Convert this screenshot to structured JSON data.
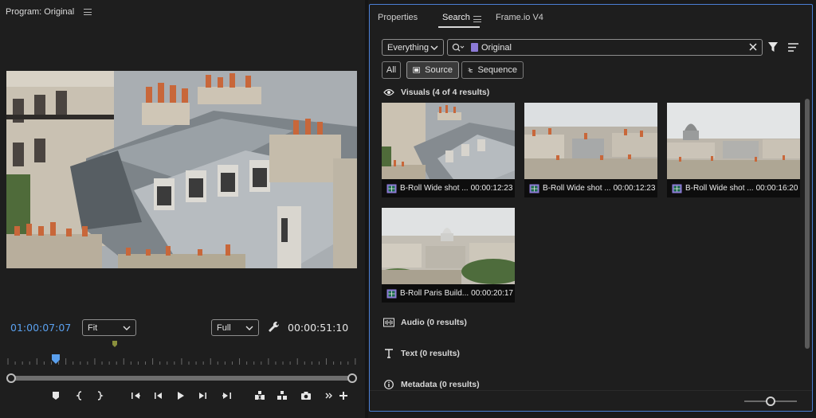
{
  "program": {
    "title": "Program: Original",
    "current_timecode": "01:00:07:07",
    "fit_value": "Fit",
    "resolution_value": "Full",
    "duration_timecode": "00:00:51:10",
    "playhead_fraction": 0.14,
    "transport_icons": [
      "add-marker-icon",
      "mark-in-icon",
      "mark-out-icon",
      "go-to-in-icon",
      "step-back-icon",
      "play-icon",
      "step-forward-icon",
      "go-to-out-icon",
      "lift-icon",
      "extract-icon",
      "export-frame-icon",
      "more-icon",
      "add-button-icon"
    ]
  },
  "search": {
    "tabs": [
      {
        "label": "Properties"
      },
      {
        "label": "Search"
      },
      {
        "label": "Frame.io V4"
      }
    ],
    "active_tab": "Search",
    "scope_value": "Everything",
    "query_value": "Original",
    "filter_chips": {
      "all": "All",
      "source": "Source",
      "sequence": "Sequence"
    },
    "active_chip": "Source",
    "visuals_header": "Visuals (4 of 4 results)",
    "results": [
      {
        "name": "B-Roll Wide shot ...",
        "duration": "00:00:12:23"
      },
      {
        "name": "B-Roll Wide shot ...",
        "duration": "00:00:12:23"
      },
      {
        "name": "B-Roll Wide shot ...",
        "duration": "00:00:16:20"
      },
      {
        "name": "B-Roll Paris Build...",
        "duration": "00:00:20:17"
      }
    ],
    "audio_header": "Audio (0 results)",
    "text_header": "Text (0 results)",
    "metadata_header": "Metadata (0 results)",
    "thumbnail_size_fraction": 0.5
  },
  "colors": {
    "accent_blue": "#5aa0ee",
    "panel_border": "#4b7fd6",
    "clip_violet": "#8c7ad6"
  }
}
